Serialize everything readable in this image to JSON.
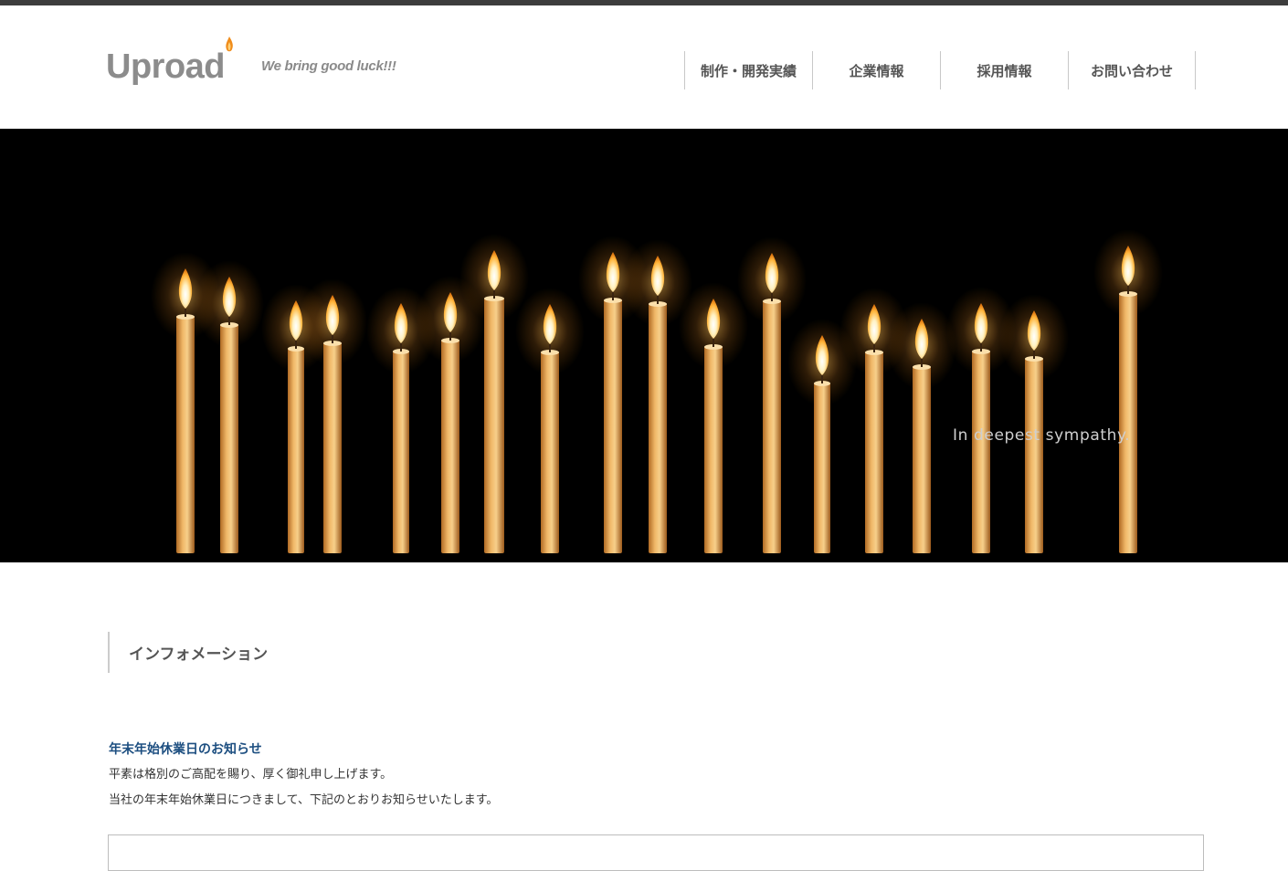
{
  "header": {
    "logo_text": "Uproad",
    "tagline": "We bring good luck!!!"
  },
  "nav": {
    "items": [
      {
        "label": "制作・開発実績"
      },
      {
        "label": "企業情報"
      },
      {
        "label": "採用情報"
      },
      {
        "label": "お問い合わせ"
      }
    ]
  },
  "hero": {
    "caption": "In deepest sympathy."
  },
  "main": {
    "section_title": "インフォメーション",
    "notice": {
      "title": "年末年始休業日のお知らせ",
      "lines": [
        "平素は格別のご高配を賜り、厚く御礼申し上げます。",
        "当社の年末年始休業日につきまして、下記のとおりお知らせいたします。"
      ]
    }
  },
  "colors": {
    "top_bar": "#3d3d3d",
    "notice_title": "#1c4e80",
    "hero_background": "#000000",
    "flame": "#f6a623"
  }
}
